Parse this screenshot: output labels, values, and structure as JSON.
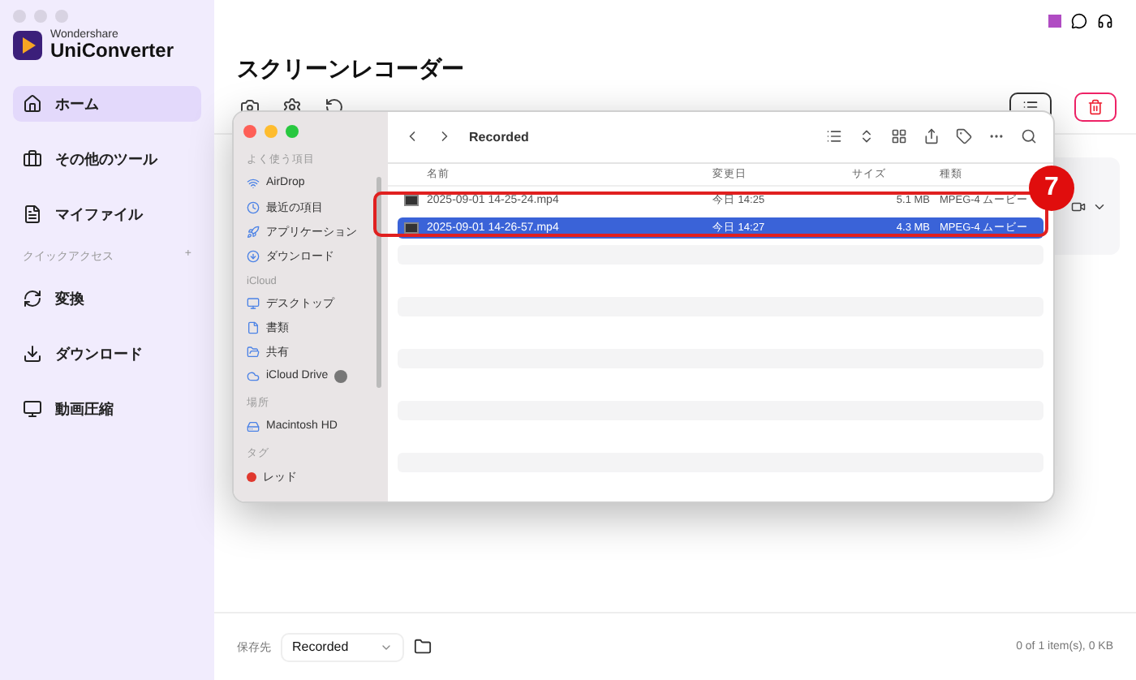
{
  "app": {
    "brand_small": "Wondershare",
    "brand": "UniConverter"
  },
  "nav": [
    {
      "label": "ホーム",
      "selected": true
    },
    {
      "label": "その他のツール",
      "selected": false
    },
    {
      "label": "マイファイル",
      "selected": false
    }
  ],
  "quick_access": {
    "title": "クイックアクセス",
    "add": "+",
    "items": [
      {
        "label": "変換",
        "selected": false
      },
      {
        "label": "ダウンロード",
        "selected": false
      },
      {
        "label": "動画圧縮",
        "selected": false
      }
    ]
  },
  "page_title": "スクリーンレコーダー",
  "finder": {
    "location": "Recorded",
    "sidebar": [
      {
        "title": "よく使う項目",
        "items": [
          {
            "label": "AirDrop"
          },
          {
            "label": "最近の項目"
          },
          {
            "label": "アプリケーション"
          },
          {
            "label": "ダウンロード"
          }
        ]
      },
      {
        "title": "iCloud",
        "items": [
          {
            "label": "デスクトップ"
          },
          {
            "label": "書類"
          },
          {
            "label": "共有"
          },
          {
            "label": "iCloud Drive"
          }
        ]
      },
      {
        "title": "場所",
        "items": [
          {
            "label": "Macintosh HD"
          }
        ]
      },
      {
        "title": "タグ",
        "items": [
          {
            "label": "レッド",
            "color": "#e0382e"
          }
        ]
      }
    ],
    "columns": [
      "名前",
      "変更日",
      "サイズ",
      "種類"
    ],
    "files": [
      {
        "name": "2025-09-01 14-25-24.mp4",
        "modified": "今日 14:25",
        "size": "5.1 MB",
        "kind": "MPEG-4 ムービー",
        "selected": false
      },
      {
        "name": "2025-09-01 14-26-57.mp4",
        "modified": "今日 14:27",
        "size": "4.3 MB",
        "kind": "MPEG-4 ムービー",
        "selected": true
      }
    ]
  },
  "annotation": {
    "number": "7"
  },
  "footer": {
    "save_label": "保存先",
    "save_path": "Recorded",
    "summary": "0 of 1 item(s), 0 KB"
  }
}
